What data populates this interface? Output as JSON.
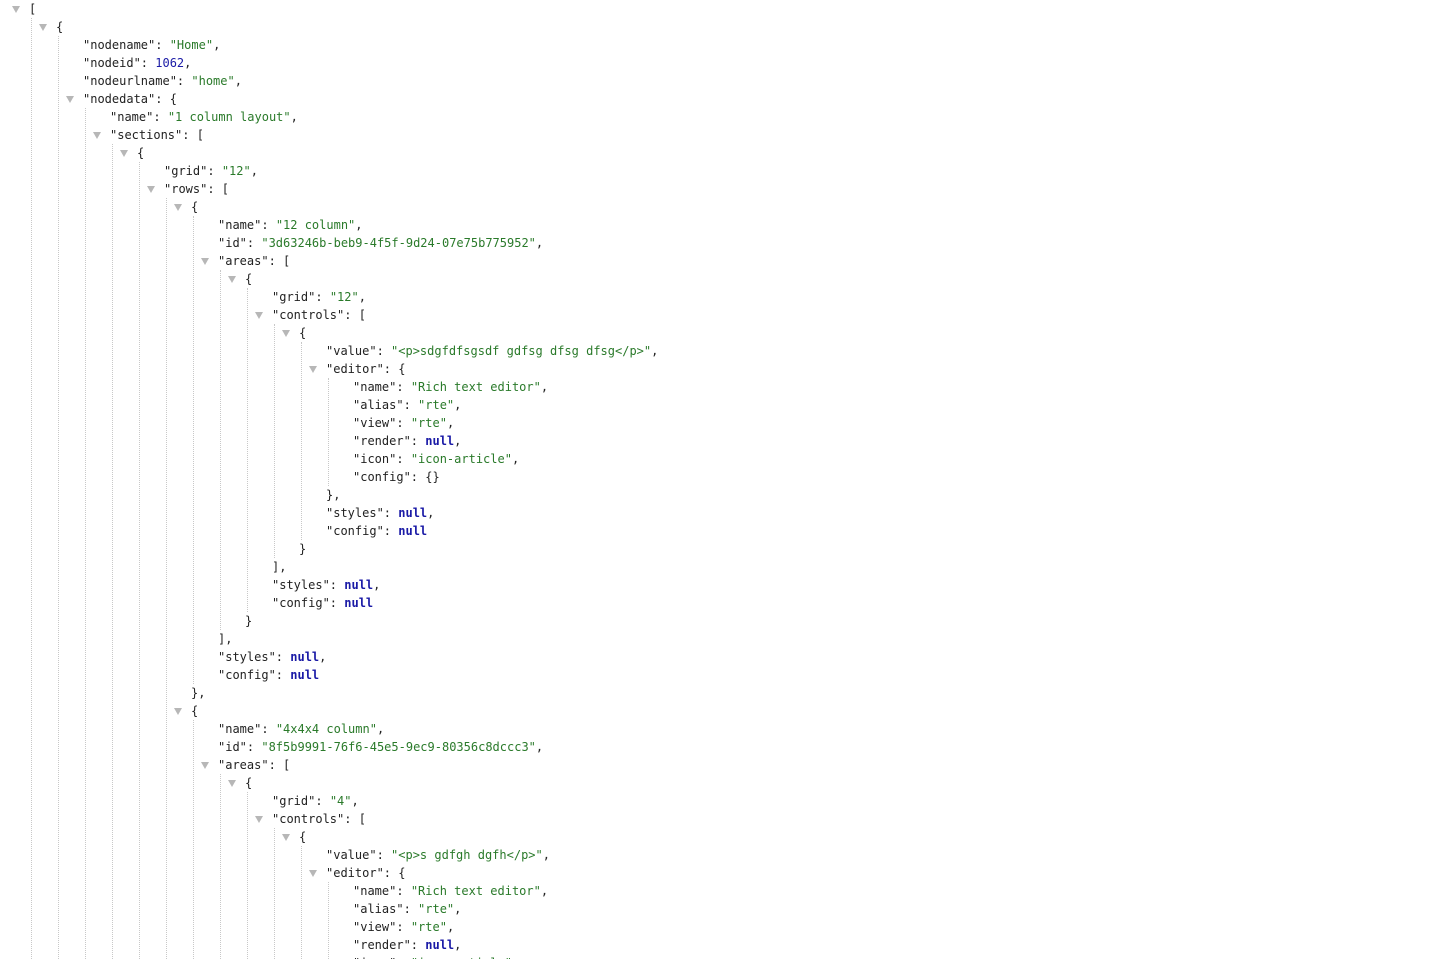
{
  "viewer": {
    "lines": [
      {
        "d": 0,
        "toggle": true,
        "parts": [
          [
            "punct",
            "["
          ]
        ]
      },
      {
        "d": 1,
        "toggle": true,
        "parts": [
          [
            "punct",
            "{"
          ]
        ]
      },
      {
        "d": 2,
        "parts": [
          [
            "key",
            "\"nodename\""
          ],
          [
            "punct",
            ": "
          ],
          [
            "str",
            "\"Home\""
          ],
          [
            "punct",
            ","
          ]
        ]
      },
      {
        "d": 2,
        "parts": [
          [
            "key",
            "\"nodeid\""
          ],
          [
            "punct",
            ": "
          ],
          [
            "num",
            "1062"
          ],
          [
            "punct",
            ","
          ]
        ]
      },
      {
        "d": 2,
        "parts": [
          [
            "key",
            "\"nodeurlname\""
          ],
          [
            "punct",
            ": "
          ],
          [
            "str",
            "\"home\""
          ],
          [
            "punct",
            ","
          ]
        ]
      },
      {
        "d": 2,
        "toggle": true,
        "parts": [
          [
            "key",
            "\"nodedata\""
          ],
          [
            "punct",
            ": {"
          ]
        ]
      },
      {
        "d": 3,
        "parts": [
          [
            "key",
            "\"name\""
          ],
          [
            "punct",
            ": "
          ],
          [
            "str",
            "\"1 column layout\""
          ],
          [
            "punct",
            ","
          ]
        ]
      },
      {
        "d": 3,
        "toggle": true,
        "parts": [
          [
            "key",
            "\"sections\""
          ],
          [
            "punct",
            ": ["
          ]
        ]
      },
      {
        "d": 4,
        "toggle": true,
        "parts": [
          [
            "punct",
            "{"
          ]
        ]
      },
      {
        "d": 5,
        "parts": [
          [
            "key",
            "\"grid\""
          ],
          [
            "punct",
            ": "
          ],
          [
            "str",
            "\"12\""
          ],
          [
            "punct",
            ","
          ]
        ]
      },
      {
        "d": 5,
        "toggle": true,
        "parts": [
          [
            "key",
            "\"rows\""
          ],
          [
            "punct",
            ": ["
          ]
        ]
      },
      {
        "d": 6,
        "toggle": true,
        "parts": [
          [
            "punct",
            "{"
          ]
        ]
      },
      {
        "d": 7,
        "parts": [
          [
            "key",
            "\"name\""
          ],
          [
            "punct",
            ": "
          ],
          [
            "str",
            "\"12 column\""
          ],
          [
            "punct",
            ","
          ]
        ]
      },
      {
        "d": 7,
        "parts": [
          [
            "key",
            "\"id\""
          ],
          [
            "punct",
            ": "
          ],
          [
            "str",
            "\"3d63246b-beb9-4f5f-9d24-07e75b775952\""
          ],
          [
            "punct",
            ","
          ]
        ]
      },
      {
        "d": 7,
        "toggle": true,
        "parts": [
          [
            "key",
            "\"areas\""
          ],
          [
            "punct",
            ": ["
          ]
        ]
      },
      {
        "d": 8,
        "toggle": true,
        "parts": [
          [
            "punct",
            "{"
          ]
        ]
      },
      {
        "d": 9,
        "parts": [
          [
            "key",
            "\"grid\""
          ],
          [
            "punct",
            ": "
          ],
          [
            "str",
            "\"12\""
          ],
          [
            "punct",
            ","
          ]
        ]
      },
      {
        "d": 9,
        "toggle": true,
        "parts": [
          [
            "key",
            "\"controls\""
          ],
          [
            "punct",
            ": ["
          ]
        ]
      },
      {
        "d": 10,
        "toggle": true,
        "parts": [
          [
            "punct",
            "{"
          ]
        ]
      },
      {
        "d": 11,
        "parts": [
          [
            "key",
            "\"value\""
          ],
          [
            "punct",
            ": "
          ],
          [
            "str",
            "\"<p>sdgfdfsgsdf gdfsg dfsg dfsg</p>\""
          ],
          [
            "punct",
            ","
          ]
        ]
      },
      {
        "d": 11,
        "toggle": true,
        "parts": [
          [
            "key",
            "\"editor\""
          ],
          [
            "punct",
            ": {"
          ]
        ]
      },
      {
        "d": 12,
        "parts": [
          [
            "key",
            "\"name\""
          ],
          [
            "punct",
            ": "
          ],
          [
            "str",
            "\"Rich text editor\""
          ],
          [
            "punct",
            ","
          ]
        ]
      },
      {
        "d": 12,
        "parts": [
          [
            "key",
            "\"alias\""
          ],
          [
            "punct",
            ": "
          ],
          [
            "str",
            "\"rte\""
          ],
          [
            "punct",
            ","
          ]
        ]
      },
      {
        "d": 12,
        "parts": [
          [
            "key",
            "\"view\""
          ],
          [
            "punct",
            ": "
          ],
          [
            "str",
            "\"rte\""
          ],
          [
            "punct",
            ","
          ]
        ]
      },
      {
        "d": 12,
        "parts": [
          [
            "key",
            "\"render\""
          ],
          [
            "punct",
            ": "
          ],
          [
            "nul",
            "null"
          ],
          [
            "punct",
            ","
          ]
        ]
      },
      {
        "d": 12,
        "parts": [
          [
            "key",
            "\"icon\""
          ],
          [
            "punct",
            ": "
          ],
          [
            "str",
            "\"icon-article\""
          ],
          [
            "punct",
            ","
          ]
        ]
      },
      {
        "d": 12,
        "parts": [
          [
            "key",
            "\"config\""
          ],
          [
            "punct",
            ": {}"
          ]
        ]
      },
      {
        "d": 11,
        "parts": [
          [
            "punct",
            "},"
          ]
        ]
      },
      {
        "d": 11,
        "parts": [
          [
            "key",
            "\"styles\""
          ],
          [
            "punct",
            ": "
          ],
          [
            "nul",
            "null"
          ],
          [
            "punct",
            ","
          ]
        ]
      },
      {
        "d": 11,
        "parts": [
          [
            "key",
            "\"config\""
          ],
          [
            "punct",
            ": "
          ],
          [
            "nul",
            "null"
          ]
        ]
      },
      {
        "d": 10,
        "parts": [
          [
            "punct",
            "}"
          ]
        ]
      },
      {
        "d": 9,
        "parts": [
          [
            "punct",
            "],"
          ]
        ]
      },
      {
        "d": 9,
        "parts": [
          [
            "key",
            "\"styles\""
          ],
          [
            "punct",
            ": "
          ],
          [
            "nul",
            "null"
          ],
          [
            "punct",
            ","
          ]
        ]
      },
      {
        "d": 9,
        "parts": [
          [
            "key",
            "\"config\""
          ],
          [
            "punct",
            ": "
          ],
          [
            "nul",
            "null"
          ]
        ]
      },
      {
        "d": 8,
        "parts": [
          [
            "punct",
            "}"
          ]
        ]
      },
      {
        "d": 7,
        "parts": [
          [
            "punct",
            "],"
          ]
        ]
      },
      {
        "d": 7,
        "parts": [
          [
            "key",
            "\"styles\""
          ],
          [
            "punct",
            ": "
          ],
          [
            "nul",
            "null"
          ],
          [
            "punct",
            ","
          ]
        ]
      },
      {
        "d": 7,
        "parts": [
          [
            "key",
            "\"config\""
          ],
          [
            "punct",
            ": "
          ],
          [
            "nul",
            "null"
          ]
        ]
      },
      {
        "d": 6,
        "parts": [
          [
            "punct",
            "},"
          ]
        ]
      },
      {
        "d": 6,
        "toggle": true,
        "parts": [
          [
            "punct",
            "{"
          ]
        ]
      },
      {
        "d": 7,
        "parts": [
          [
            "key",
            "\"name\""
          ],
          [
            "punct",
            ": "
          ],
          [
            "str",
            "\"4x4x4 column\""
          ],
          [
            "punct",
            ","
          ]
        ]
      },
      {
        "d": 7,
        "parts": [
          [
            "key",
            "\"id\""
          ],
          [
            "punct",
            ": "
          ],
          [
            "str",
            "\"8f5b9991-76f6-45e5-9ec9-80356c8dccc3\""
          ],
          [
            "punct",
            ","
          ]
        ]
      },
      {
        "d": 7,
        "toggle": true,
        "parts": [
          [
            "key",
            "\"areas\""
          ],
          [
            "punct",
            ": ["
          ]
        ]
      },
      {
        "d": 8,
        "toggle": true,
        "parts": [
          [
            "punct",
            "{"
          ]
        ]
      },
      {
        "d": 9,
        "parts": [
          [
            "key",
            "\"grid\""
          ],
          [
            "punct",
            ": "
          ],
          [
            "str",
            "\"4\""
          ],
          [
            "punct",
            ","
          ]
        ]
      },
      {
        "d": 9,
        "toggle": true,
        "parts": [
          [
            "key",
            "\"controls\""
          ],
          [
            "punct",
            ": ["
          ]
        ]
      },
      {
        "d": 10,
        "toggle": true,
        "parts": [
          [
            "punct",
            "{"
          ]
        ]
      },
      {
        "d": 11,
        "parts": [
          [
            "key",
            "\"value\""
          ],
          [
            "punct",
            ": "
          ],
          [
            "str",
            "\"<p>s gdfgh dgfh</p>\""
          ],
          [
            "punct",
            ","
          ]
        ]
      },
      {
        "d": 11,
        "toggle": true,
        "parts": [
          [
            "key",
            "\"editor\""
          ],
          [
            "punct",
            ": {"
          ]
        ]
      },
      {
        "d": 12,
        "parts": [
          [
            "key",
            "\"name\""
          ],
          [
            "punct",
            ": "
          ],
          [
            "str",
            "\"Rich text editor\""
          ],
          [
            "punct",
            ","
          ]
        ]
      },
      {
        "d": 12,
        "parts": [
          [
            "key",
            "\"alias\""
          ],
          [
            "punct",
            ": "
          ],
          [
            "str",
            "\"rte\""
          ],
          [
            "punct",
            ","
          ]
        ]
      },
      {
        "d": 12,
        "parts": [
          [
            "key",
            "\"view\""
          ],
          [
            "punct",
            ": "
          ],
          [
            "str",
            "\"rte\""
          ],
          [
            "punct",
            ","
          ]
        ]
      },
      {
        "d": 12,
        "parts": [
          [
            "key",
            "\"render\""
          ],
          [
            "punct",
            ": "
          ],
          [
            "nul",
            "null"
          ],
          [
            "punct",
            ","
          ]
        ]
      },
      {
        "d": 12,
        "parts": [
          [
            "key",
            "\"icon\""
          ],
          [
            "punct",
            ": "
          ],
          [
            "str",
            "\"icon-article\""
          ],
          [
            "punct",
            ","
          ]
        ]
      }
    ]
  }
}
